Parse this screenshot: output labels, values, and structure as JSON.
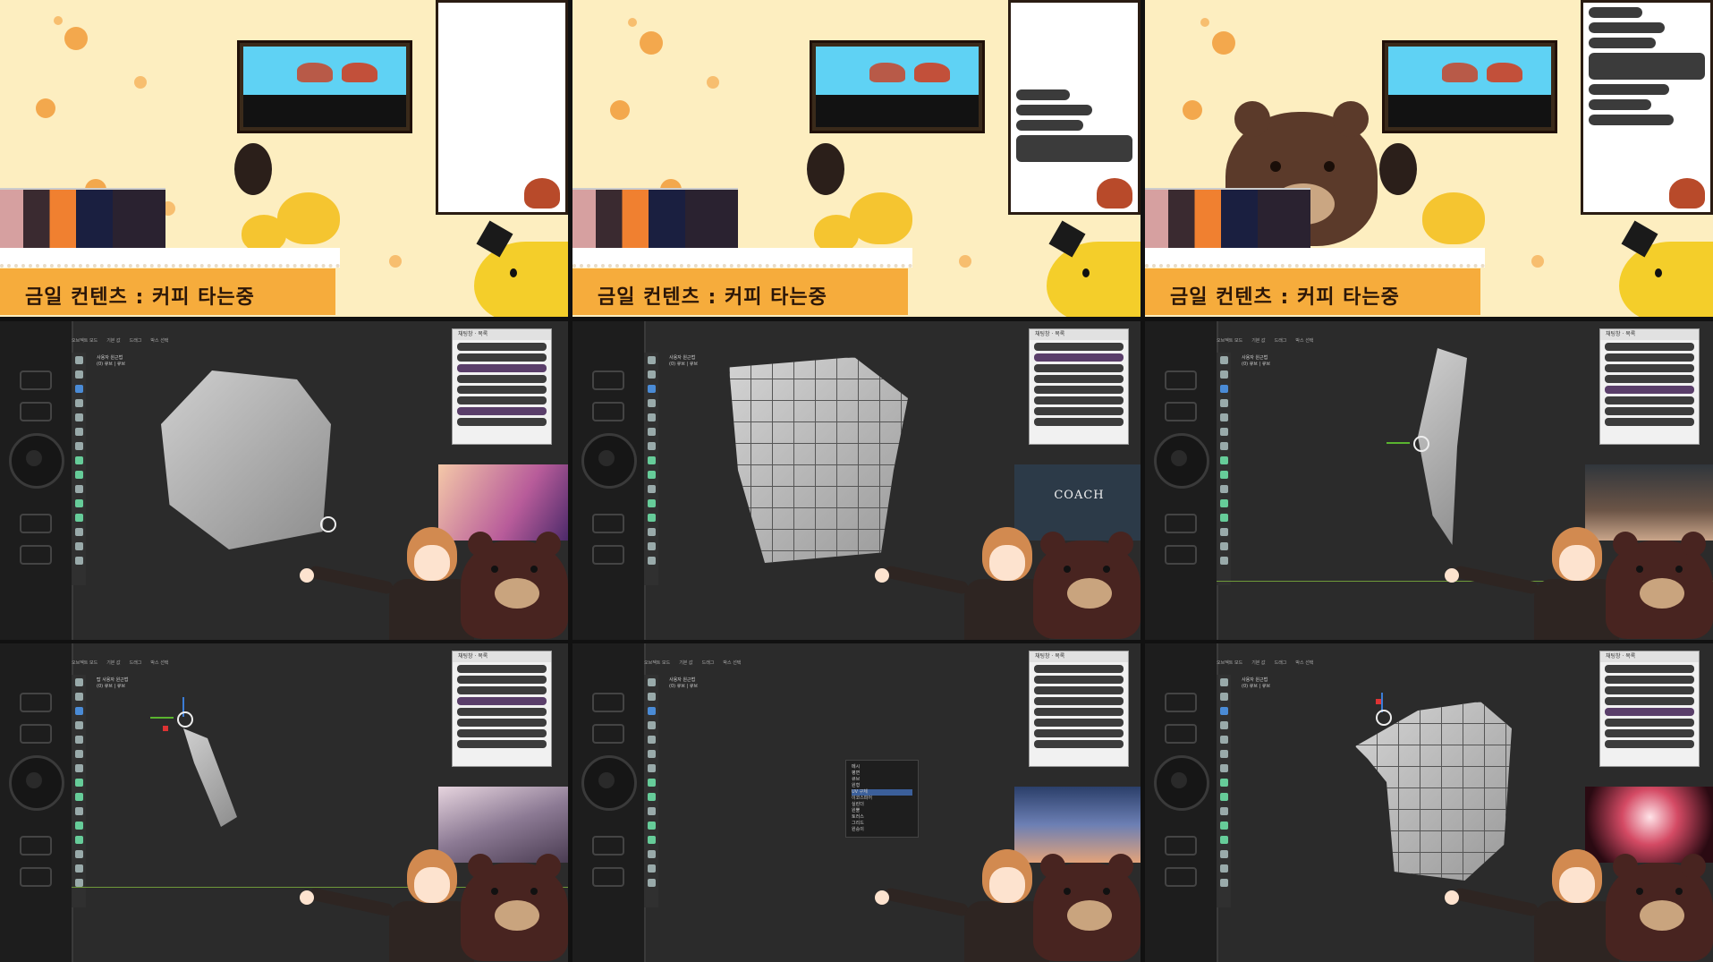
{
  "stream": {
    "caption": "금일 컨텐츠 : 커피 타는중"
  },
  "blender": {
    "header_items": [
      "오브젝트 모드",
      "기본 값",
      "드래그",
      "박스 선택"
    ],
    "viewport_info": [
      "사용자 원근법",
      "(0) 큐브 | 큐브"
    ],
    "topview_label": "탑 사용자 원근법",
    "chat_title": "채팅창  ·  목록",
    "context_menu": {
      "title": "메시",
      "items": [
        "평면",
        "큐브",
        "원형",
        "UV 구체",
        "이코스피어",
        "실린더",
        "원뿔",
        "토러스",
        "그리드",
        "원숭이"
      ],
      "highlighted": "UV 구체"
    },
    "video_text": "COACH"
  },
  "colors": {
    "background": "#fdeec0",
    "paw": "#f2a040",
    "caption_bar": "#f6ac3c",
    "viewport": "#2b2b2b",
    "gizmo_y": "#3b7cd6",
    "gizmo_x": "#59b42f"
  }
}
